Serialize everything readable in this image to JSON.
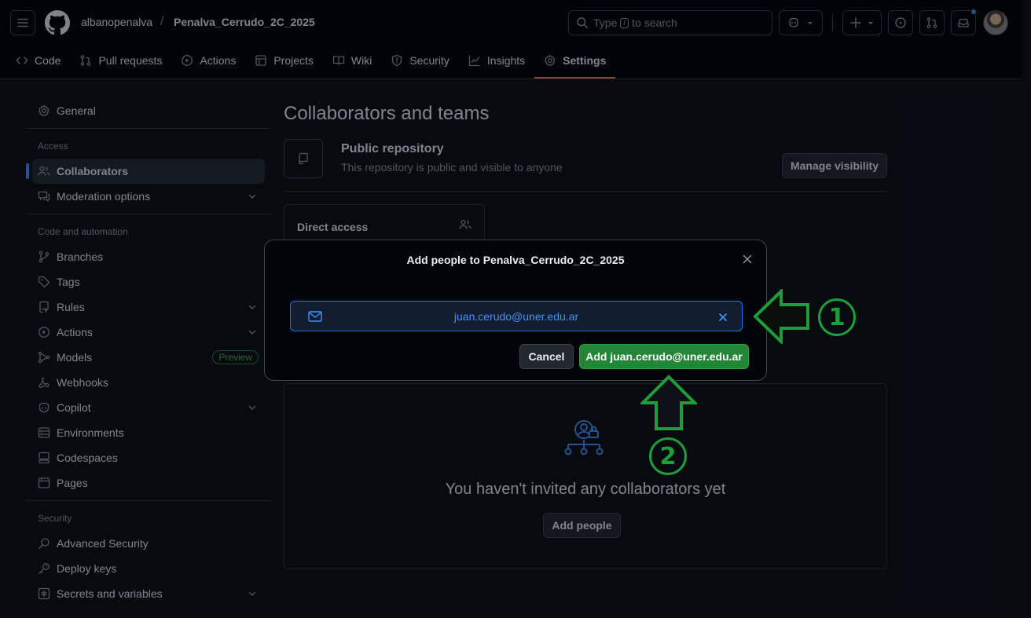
{
  "header": {
    "owner": "albanopenalva",
    "separator": "/",
    "repo": "Penalva_Cerrudo_2C_2025",
    "search_prefix": "Type",
    "search_key": "/",
    "search_suffix": "to search"
  },
  "tabs": [
    {
      "label": "Code",
      "icon": "code-icon"
    },
    {
      "label": "Pull requests",
      "icon": "pull-request-icon"
    },
    {
      "label": "Actions",
      "icon": "play-icon"
    },
    {
      "label": "Projects",
      "icon": "table-icon"
    },
    {
      "label": "Wiki",
      "icon": "book-icon"
    },
    {
      "label": "Security",
      "icon": "shield-icon"
    },
    {
      "label": "Insights",
      "icon": "graph-icon"
    },
    {
      "label": "Settings",
      "icon": "gear-icon",
      "selected": true
    }
  ],
  "sidebar": {
    "general": "General",
    "access_heading": "Access",
    "collaborators": "Collaborators",
    "moderation": "Moderation options",
    "code_heading": "Code and automation",
    "branches": "Branches",
    "tags": "Tags",
    "rules": "Rules",
    "actions": "Actions",
    "models": "Models",
    "preview_badge": "Preview",
    "webhooks": "Webhooks",
    "copilot": "Copilot",
    "environments": "Environments",
    "codespaces": "Codespaces",
    "pages": "Pages",
    "security_heading": "Security",
    "advanced_security": "Advanced Security",
    "deploy_keys": "Deploy keys",
    "secrets": "Secrets and variables"
  },
  "main": {
    "title": "Collaborators and teams",
    "public_title": "Public repository",
    "public_desc": "This repository is public and visible to anyone",
    "manage_visibility": "Manage visibility",
    "direct_access": "Direct access",
    "empty_text": "You haven't invited any collaborators yet",
    "add_people": "Add people"
  },
  "modal": {
    "title": "Add people to Penalva_Cerrudo_2C_2025",
    "chip_email": "juan.cerudo@uner.edu.ar",
    "cancel": "Cancel",
    "add_button": "Add juan.cerudo@uner.edu.ar"
  },
  "annotations": {
    "step1": "1",
    "step2": "2"
  },
  "colors": {
    "accent_blue": "#4493f8",
    "primary_green": "#238636",
    "annotation_green": "#1e9e3a",
    "tab_underline": "#f78166"
  }
}
